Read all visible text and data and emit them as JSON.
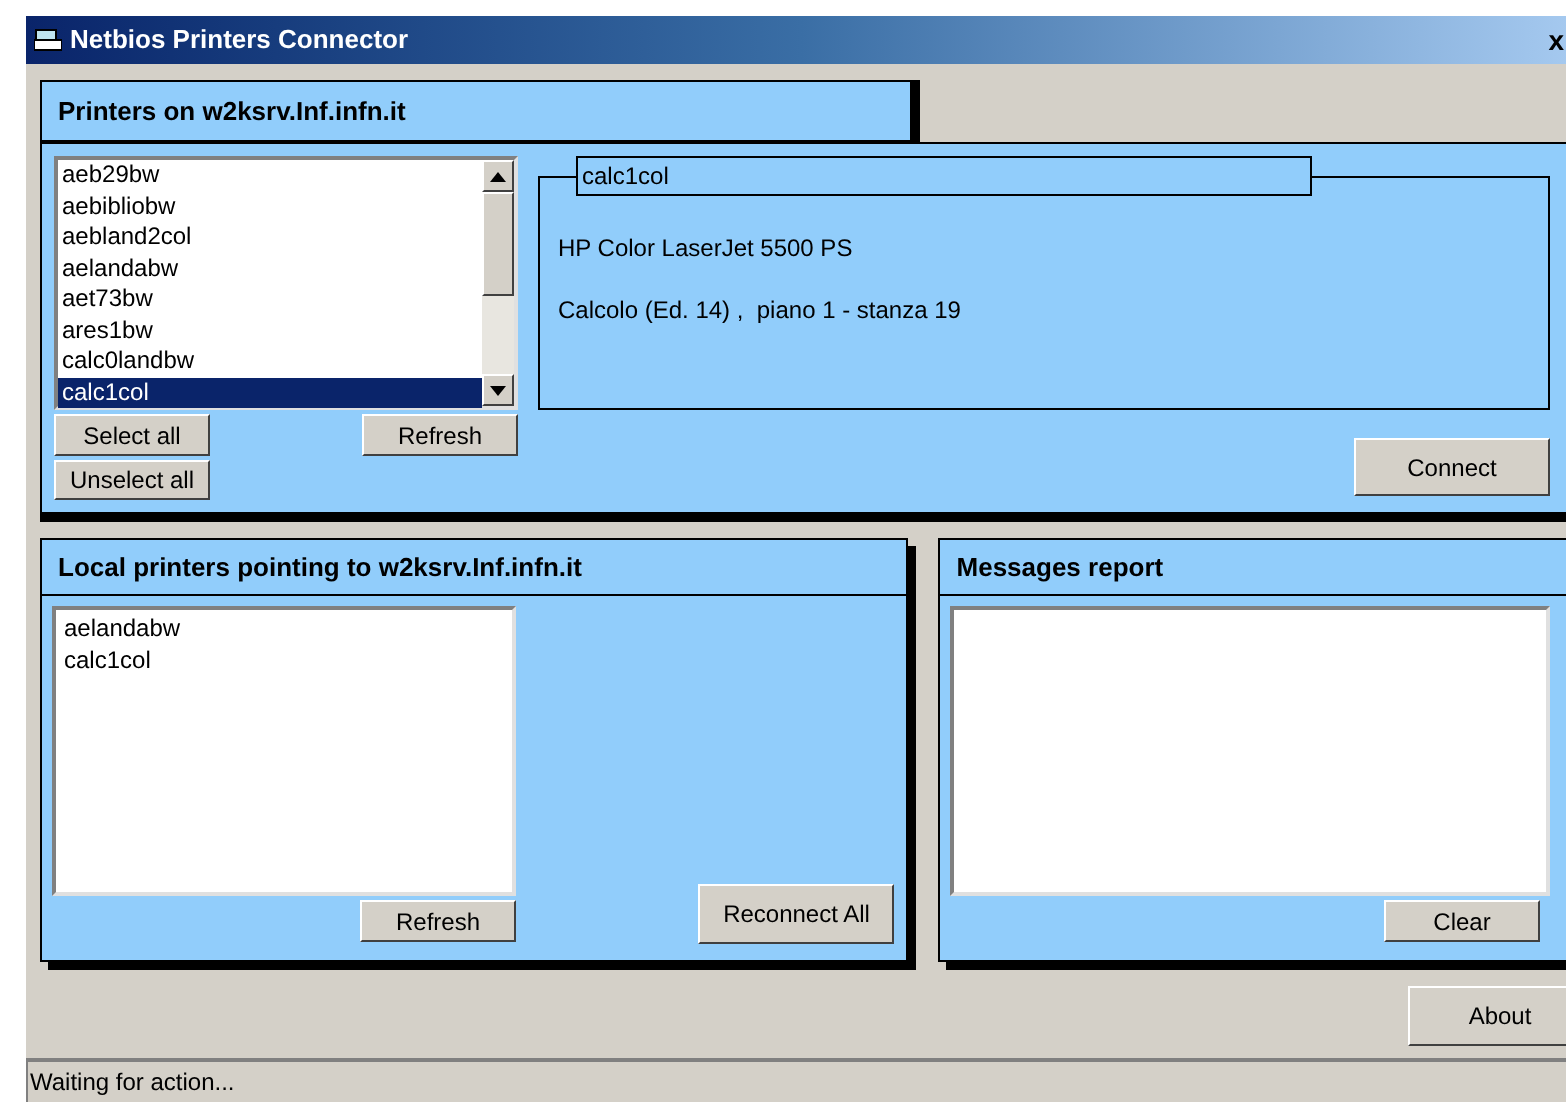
{
  "window": {
    "title": "Netbios Printers Connector",
    "close": "x"
  },
  "printers_panel": {
    "title": "Printers on w2ksrv.Inf.infn.it",
    "items": [
      {
        "label": "aeb29bw",
        "selected": false
      },
      {
        "label": "aebibliobw",
        "selected": false
      },
      {
        "label": "aebland2col",
        "selected": false
      },
      {
        "label": "aelandabw",
        "selected": false
      },
      {
        "label": "aet73bw",
        "selected": false
      },
      {
        "label": "ares1bw",
        "selected": false
      },
      {
        "label": "calc0landbw",
        "selected": false
      },
      {
        "label": "calc1col",
        "selected": true
      }
    ],
    "buttons": {
      "select_all": "Select all",
      "refresh": "Refresh",
      "unselect_all": "Unselect all"
    },
    "details": {
      "name": "calc1col",
      "model": "HP Color LaserJet 5500 PS",
      "location": "Calcolo (Ed. 14) ,  piano 1 - stanza 19"
    },
    "connect": "Connect"
  },
  "local_panel": {
    "title": "Local printers pointing to w2ksrv.Inf.infn.it",
    "items": [
      "aelandabw",
      "calc1col"
    ],
    "refresh": "Refresh",
    "reconnect_all": "Reconnect All"
  },
  "messages_panel": {
    "title": "Messages report",
    "clear": "Clear"
  },
  "about": "About",
  "status_bar": "Waiting for action..."
}
